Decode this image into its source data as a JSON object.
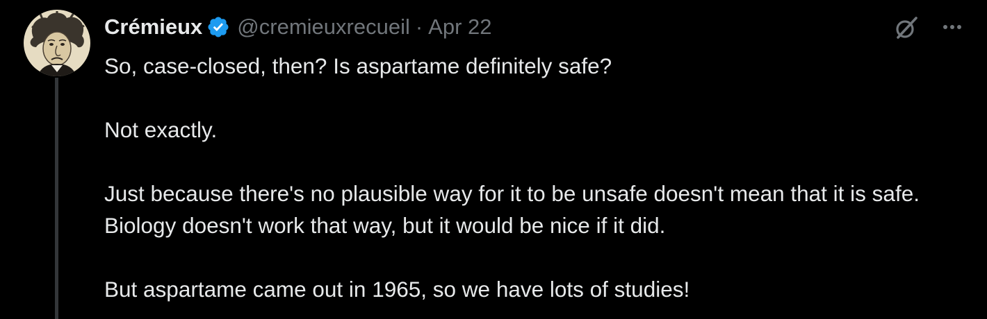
{
  "tweet": {
    "author": {
      "display_name": "Crémieux",
      "handle": "@cremieuxrecueil",
      "verified": true
    },
    "separator": "·",
    "date": "Apr 22",
    "paragraphs": [
      "So, case-closed, then? Is aspartame definitely safe?",
      "Not exactly.",
      "Just because there's no plausible way for it to be unsafe doesn't mean that it is safe. Biology doesn't work that way, but it would be nice if it did.",
      "But aspartame came out in 1965, so we have lots of studies!"
    ],
    "more_label": "···"
  },
  "icons": {
    "avatar": "avatar-caricature",
    "verified": "verified-badge-icon",
    "grok": "grok-icon",
    "more": "more-options-icon"
  },
  "colors": {
    "background": "#000000",
    "text_primary": "#e7e9ea",
    "text_secondary": "#71767b",
    "verified_blue": "#1d9bf0",
    "thread_line": "#333639"
  }
}
